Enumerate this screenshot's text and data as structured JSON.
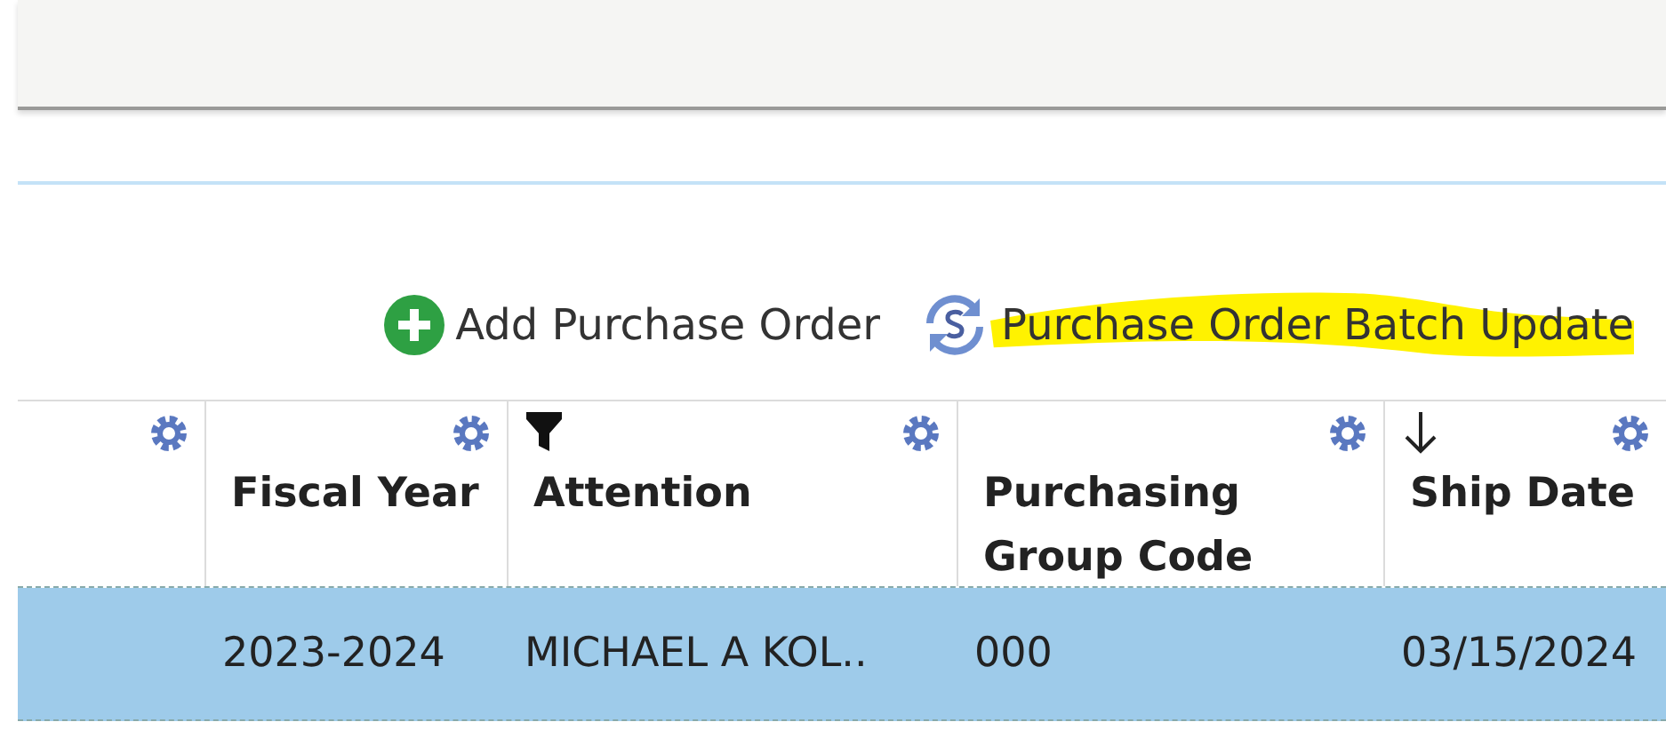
{
  "toolbar": [
    {
      "kind": "add",
      "label": "Add Purchase Order",
      "highlighted": false
    },
    {
      "kind": "sync",
      "label": "Purchase Order Batch Update",
      "highlighted": true
    }
  ],
  "table": {
    "columns": [
      {
        "filtered": false,
        "sorted": false
      },
      {
        "label": "Fiscal Year",
        "filtered": false,
        "sorted": false
      },
      {
        "label": "Attention",
        "filtered": true,
        "sorted": false
      },
      {
        "label": "Purchasing Group Code",
        "filtered": false,
        "sorted": false
      },
      {
        "label": "Ship Date",
        "filtered": false,
        "sorted": true
      }
    ],
    "rows": [
      {
        "selected": true,
        "cells": [
          "",
          "2023-2024",
          "MICHAEL A KOL..",
          "000",
          "03/15/2024"
        ]
      }
    ]
  }
}
